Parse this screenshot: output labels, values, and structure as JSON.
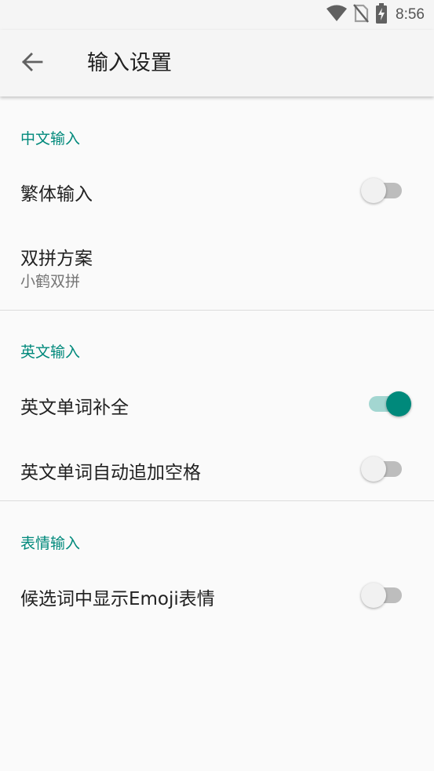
{
  "status_bar": {
    "time": "8:56",
    "icons": [
      "wifi-icon",
      "no-sim-icon",
      "battery-charging-icon"
    ]
  },
  "app_bar": {
    "title": "输入设置",
    "back_icon": "arrow-back-icon"
  },
  "sections": [
    {
      "header": "中文输入",
      "prefs": [
        {
          "title": "繁体输入",
          "switch": false
        },
        {
          "title": "双拼方案",
          "summary": "小鹤双拼"
        }
      ]
    },
    {
      "header": "英文输入",
      "prefs": [
        {
          "title": "英文单词补全",
          "switch": true
        },
        {
          "title": "英文单词自动追加空格",
          "switch": false
        }
      ]
    },
    {
      "header": "表情输入",
      "prefs": [
        {
          "title": "候选词中显示Emoji表情",
          "switch": false
        }
      ]
    }
  ],
  "colors": {
    "accent": "#00897b",
    "accent_track": "#a3d6d1",
    "background": "#fafafa",
    "app_bar": "#f5f5f5"
  }
}
